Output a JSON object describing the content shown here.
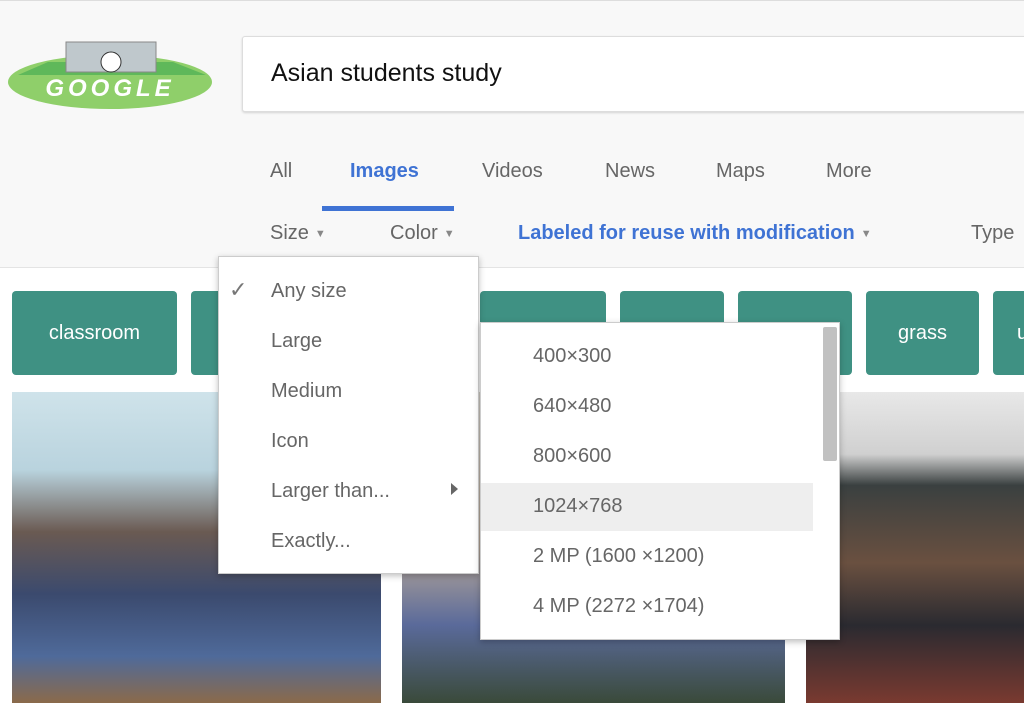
{
  "logo": {
    "text": "GOOGLE"
  },
  "search": {
    "query": "Asian students study"
  },
  "tabs": [
    {
      "label": "All"
    },
    {
      "label": "Images",
      "active": true
    },
    {
      "label": "Videos"
    },
    {
      "label": "News"
    },
    {
      "label": "Maps"
    },
    {
      "label": "More"
    }
  ],
  "filters": [
    {
      "label": "Size"
    },
    {
      "label": "Color"
    },
    {
      "label": "Labeled for reuse with modification"
    },
    {
      "label": "Type"
    }
  ],
  "chips": [
    "classroom",
    "",
    "",
    "",
    "",
    "grass",
    "u"
  ],
  "size_menu": {
    "selected": "Any size",
    "items": [
      "Any size",
      "Large",
      "Medium",
      "Icon",
      "Larger than...",
      "Exactly..."
    ]
  },
  "larger_than_menu": {
    "highlighted": "1024×768",
    "items": [
      "400×300",
      "640×480",
      "800×600",
      "1024×768",
      "2 MP (1600 ×1200)",
      "4 MP (2272 ×1704)"
    ]
  },
  "colors": {
    "accent": "#3f73d4",
    "chip": "#3f9183"
  }
}
